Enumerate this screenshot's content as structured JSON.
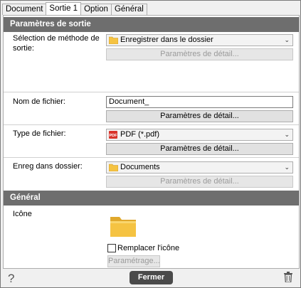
{
  "tabs": [
    "Document",
    "Sortie 1",
    "Option",
    "Général"
  ],
  "output_section": {
    "title": "Paramètres de sortie"
  },
  "method": {
    "label": "Sélection de méthode de sortie:",
    "selected": "Enregistrer dans le dossier",
    "details_button": "Paramètres de détail..."
  },
  "filename": {
    "label": "Nom de fichier:",
    "value": "Document_",
    "details_button": "Paramètres de détail..."
  },
  "filetype": {
    "label": "Type de fichier:",
    "selected": "PDF (*.pdf)",
    "details_button": "Paramètres de détail..."
  },
  "folder": {
    "label": "Enreg dans dossier:",
    "selected": "Documents",
    "details_button": "Paramètres de détail..."
  },
  "general_section": {
    "title": "Général",
    "icon_label": "Icône",
    "replace_icon_label": "Remplacer l'icône",
    "replace_icon_checked": false,
    "settings_button": "Paramétrage..."
  },
  "footer": {
    "close_button": "Fermer",
    "help_symbol": "?"
  },
  "colors": {
    "header_bg": "#6e6e6e",
    "folder_yellow": "#f5c342",
    "pdf_red": "#d9342b"
  }
}
